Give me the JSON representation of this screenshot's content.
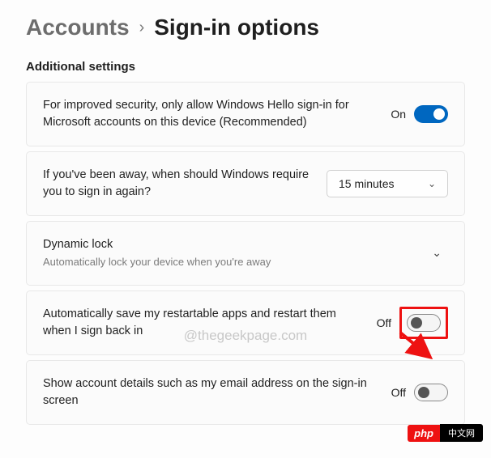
{
  "breadcrumb": {
    "parent": "Accounts",
    "current": "Sign-in options"
  },
  "section": {
    "title": "Additional settings"
  },
  "rows": {
    "hello": {
      "text": "For improved security, only allow Windows Hello sign-in for Microsoft accounts on this device (Recommended)",
      "state": "On"
    },
    "away": {
      "text": "If you've been away, when should Windows require you to sign in again?",
      "selected": "15 minutes"
    },
    "dynamic": {
      "title": "Dynamic lock",
      "subtitle": "Automatically lock your device when you're away"
    },
    "restart": {
      "text": "Automatically save my restartable apps and restart them when I sign back in",
      "state": "Off"
    },
    "details": {
      "text": "Show account details such as my email address on the sign-in screen",
      "state": "Off"
    }
  },
  "watermark": "@thegeekpage.com",
  "badge": {
    "left": "php",
    "right": "中文网"
  }
}
